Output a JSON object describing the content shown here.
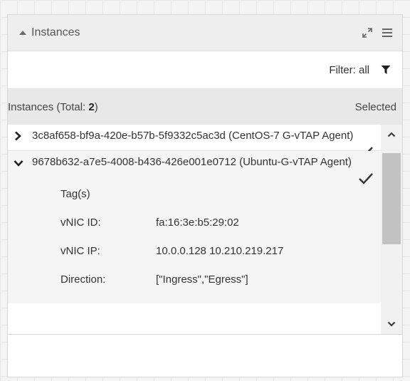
{
  "panel": {
    "title": "Instances",
    "filter_label": "Filter: all"
  },
  "list_header": {
    "count_prefix": "Instances (Total: ",
    "count": "2",
    "count_suffix": ")",
    "selected_label": "Selected"
  },
  "instances": [
    {
      "title": "3c8af658-bf9a-420e-b57b-5f9332c5ac3d (CentOS-7 G-vTAP Agent)",
      "expanded": false,
      "selected": true
    },
    {
      "title": "9678b632-a7e5-4008-b436-426e001e0712 (Ubuntu-G-vTAP Agent)",
      "expanded": true,
      "selected": true,
      "tags_label": "Tag(s)",
      "vnic_id_label": "vNIC ID:",
      "vnic_id": "fa:16:3e:b5:29:02",
      "vnic_ip_label": "vNIC IP:",
      "vnic_ip": "10.0.0.128 10.210.219.217",
      "direction_label": "Direction:",
      "direction": "[\"Ingress\",\"Egress\"]"
    }
  ],
  "icons": {
    "collapse": "caret-up-icon",
    "expand_panel": "expand-arrows-icon",
    "menu": "hamburger-menu-icon",
    "filter": "funnel-icon",
    "row_collapsed": "chevron-right-icon",
    "row_expanded": "chevron-down-icon",
    "selected": "checkmark-icon",
    "scroll_up": "scroll-up-icon",
    "scroll_down": "scroll-down-icon"
  }
}
